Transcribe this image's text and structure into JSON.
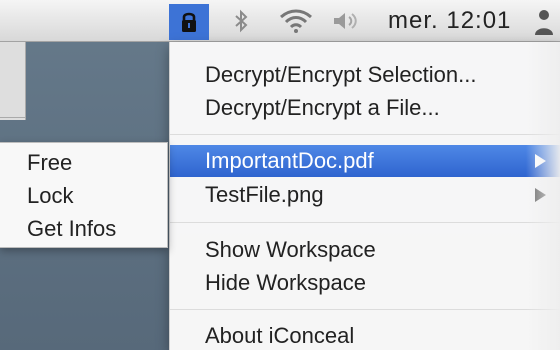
{
  "menubar": {
    "clock": "mer. 12:01",
    "icons": {
      "active": "lock-icon",
      "bluetooth": "bluetooth-icon",
      "wifi": "wifi-icon",
      "volume": "volume-icon",
      "user": "user-icon"
    }
  },
  "main_menu": {
    "items": [
      {
        "label": "Decrypt/Encrypt Selection..."
      },
      {
        "label": "Decrypt/Encrypt a File..."
      },
      {
        "label": "ImportantDoc.pdf",
        "submenu_arrow": "chevron-right-icon"
      },
      {
        "label": "TestFile.png",
        "submenu_arrow": "chevron-right-icon"
      },
      {
        "label": "Show Workspace"
      },
      {
        "label": "Hide Workspace"
      },
      {
        "label": "About iConceal"
      }
    ]
  },
  "submenu": {
    "items": [
      {
        "label": "Free"
      },
      {
        "label": "Lock"
      },
      {
        "label": "Get Infos"
      }
    ]
  },
  "colors": {
    "selection": "#3d73d6",
    "menu_background": "#f8f8f8",
    "desktop": "#5f7384"
  }
}
